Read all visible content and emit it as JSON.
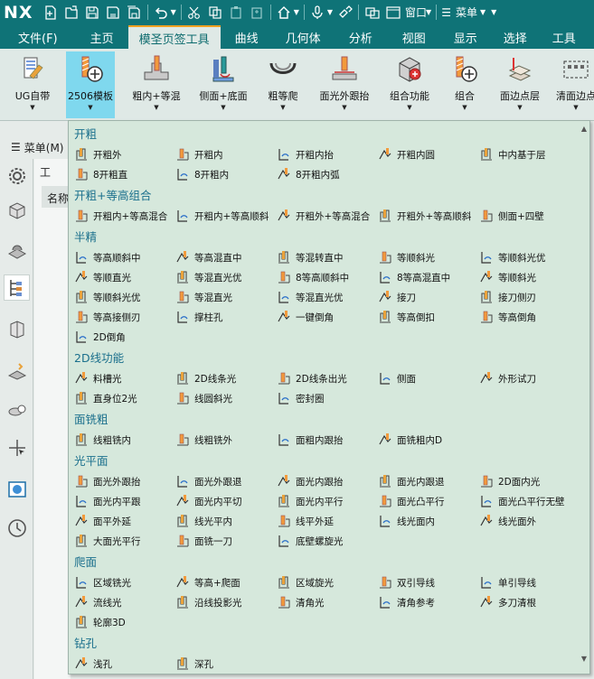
{
  "app": {
    "logo": "NX"
  },
  "quick_access": {
    "window_label": "窗口",
    "menu_label": "菜单"
  },
  "tabs": [
    {
      "label": "文件(F)"
    },
    {
      "label": "主页"
    },
    {
      "label": "模圣页签工具",
      "active": true
    },
    {
      "label": "曲线"
    },
    {
      "label": "几何体"
    },
    {
      "label": "分析"
    },
    {
      "label": "视图"
    },
    {
      "label": "显示"
    },
    {
      "label": "选择"
    },
    {
      "label": "工具"
    }
  ],
  "ribbon": [
    {
      "label": "UG自带",
      "icon": "ug-native-icon"
    },
    {
      "label": "2506模板",
      "icon": "template-2506-icon",
      "active": true
    },
    {
      "label": "粗内+等混",
      "icon": "rough-inner-icon"
    },
    {
      "label": "侧面+底面",
      "icon": "side-floor-icon"
    },
    {
      "label": "粗等爬",
      "icon": "rough-climb-icon"
    },
    {
      "label": "面光外跟抬",
      "icon": "face-finish-icon"
    },
    {
      "label": "组合功能",
      "icon": "combo-function-icon"
    },
    {
      "label": "组合",
      "icon": "combo-icon"
    },
    {
      "label": "面边点层",
      "icon": "face-edge-layer-icon"
    },
    {
      "label": "清面边点",
      "icon": "clean-face-icon"
    }
  ],
  "left": {
    "menu_button": "菜单(M)",
    "nav_tool": "工",
    "nav_column": "名称"
  },
  "gallery": {
    "accent": "#1a6f8c",
    "background": "#d6e8dc",
    "sections": [
      {
        "title": "开粗",
        "items": [
          "开粗外",
          "开粗内",
          "开粗内抬",
          "开粗内圆",
          "中内基于层",
          "8开粗直",
          "8开粗内",
          "8开粗内弧"
        ]
      },
      {
        "title": "开粗+等高组合",
        "items": [
          "开粗内+等高混合",
          "开粗内+等高顺斜",
          "开粗外+等高混合",
          "开粗外+等高顺斜",
          "侧面+四壁"
        ]
      },
      {
        "title": "半精",
        "items": [
          "等高顺斜中",
          "等高混直中",
          "等混转直中",
          "等顺斜光",
          "等顺斜光优",
          "等顺直光",
          "等混直光优",
          "8等高顺斜中",
          "8等高混直中",
          "等顺斜光",
          "等顺斜光优",
          "等混直光",
          "等混直光优",
          "接刀",
          "接刀侧刃",
          "等高接侧刃",
          "撑柱孔",
          "一键倒角",
          "等高倒扣",
          "等高倒角",
          "2D倒角"
        ]
      },
      {
        "title": "2D线功能",
        "items": [
          "料槽光",
          "2D线条光",
          "2D线条出光",
          "侧面",
          "外形试刀",
          "直身位2光",
          "线圆斜光",
          "密封圈"
        ]
      },
      {
        "title": "面铣粗",
        "items": [
          "线粗铣内",
          "线粗铣外",
          "面粗内跟抬",
          "面铣粗内D"
        ]
      },
      {
        "title": "光平面",
        "items": [
          "面光外跟抬",
          "面光外跟退",
          "面光内跟抬",
          "面光内跟退",
          "2D面内光",
          "面光内平跟",
          "面光内平切",
          "面光内平行",
          "面光凸平行",
          "面光凸平行无壁",
          "面平外延",
          "线光平内",
          "线平外延",
          "线光面内",
          "线光面外",
          "大面光平行",
          "面铣一刀",
          "底壁螺旋光"
        ]
      },
      {
        "title": "爬面",
        "items": [
          "区域铣光",
          "等高+爬面",
          "区域旋光",
          "双引导线",
          "单引导线",
          "流线光",
          "沿线投影光",
          "清角光",
          "清角参考",
          "多刀清根",
          "轮廓3D"
        ]
      },
      {
        "title": "钻孔",
        "items": [
          "浅孔",
          "深孔"
        ]
      }
    ]
  }
}
